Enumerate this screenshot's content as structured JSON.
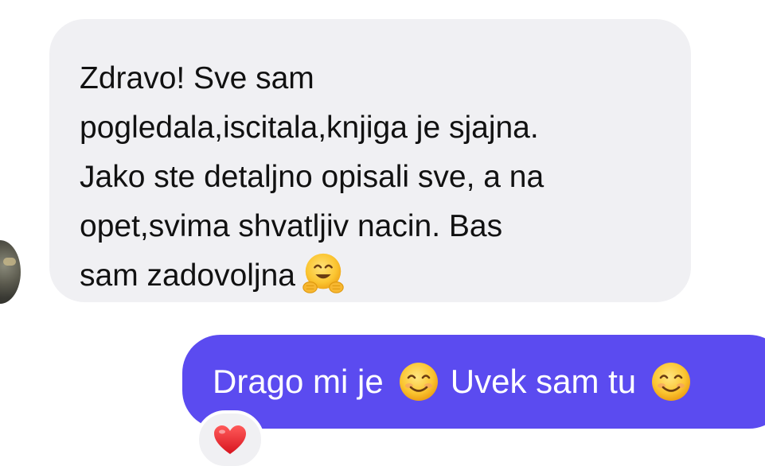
{
  "incoming_message": {
    "lines": [
      "Zdravo! Sve sam",
      "pogledala,iscitala,knjiga je sjajna.",
      "Jako ste detaljno opisali sve, a na",
      "opet,svima shvatljiv nacin. Bas",
      "sam zadovoljna"
    ],
    "emoji": "hugging-face-emoji",
    "bubble_color": "#f0f0f3"
  },
  "outgoing_message": {
    "part1": "Drago mi je",
    "part2": "Uvek sam tu",
    "emoji": "smiling-face-emoji",
    "bubble_color": "#5b4bf0"
  },
  "reaction": {
    "emoji": "red-heart-emoji"
  }
}
